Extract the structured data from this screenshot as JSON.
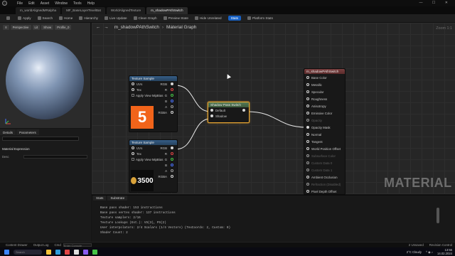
{
  "menubar": {
    "items": [
      "File",
      "Edit",
      "Asset",
      "Window",
      "Tools",
      "Help"
    ]
  },
  "tabs": [
    {
      "label": "m_worldAlignedMRalpha",
      "active": false
    },
    {
      "label": "MF_BaseLayerTexelBat",
      "active": false
    },
    {
      "label": "WorldAlignedTexture",
      "active": false
    },
    {
      "label": "m_shadowPAthSwitch",
      "active": true
    }
  ],
  "toolbar": {
    "save": "Save",
    "apply": "Apply",
    "search": "Search",
    "home": "Home",
    "hierarchy": "Hierarchy",
    "live_update": "Live Update",
    "clean_graph": "Clean Graph",
    "preview_state": "Preview State",
    "hide_unrelated": "Hide Unrelated",
    "stats": "Stats",
    "platform_stats": "Platform Stats"
  },
  "viewport": {
    "perspective": "Perspective",
    "lit": "Lit",
    "show": "Show",
    "profile": "Profile_0"
  },
  "details": {
    "tab_details": "Details",
    "tab_parameters": "Parameters",
    "section": "Material Expression",
    "desc_label": "Desc"
  },
  "graph": {
    "breadcrumb_asset": "m_shadowPAthSwitch",
    "breadcrumb_graph": "Material Graph",
    "zoom": "Zoom 1:1",
    "watermark": "MATERIAL"
  },
  "nodes": {
    "tex1": {
      "title": "Texture Sample",
      "uvs": "UVs",
      "tex": "Tex",
      "apply_mip": "Apply View MipBias",
      "outputs": [
        "RGB",
        "R",
        "G",
        "B",
        "A",
        "RGBA"
      ],
      "thumb_label": "5"
    },
    "tex2": {
      "title": "Texture Sample",
      "uvs": "UVs",
      "tex": "Tex",
      "apply_mip": "Apply View MipBias",
      "outputs": [
        "RGB",
        "R",
        "G",
        "B",
        "A",
        "RGBA"
      ],
      "thumb_label": "3500"
    },
    "switch": {
      "title": "Shadow Pass Switch",
      "input_default": "Default",
      "input_shadow": "Shadow"
    },
    "result": {
      "title": "m_shadowPAthSwitch",
      "pins": [
        {
          "label": "Base Color",
          "dim": false
        },
        {
          "label": "Metallic",
          "dim": false
        },
        {
          "label": "Specular",
          "dim": false
        },
        {
          "label": "Roughness",
          "dim": false
        },
        {
          "label": "Anisotropy",
          "dim": false
        },
        {
          "label": "Emissive Color",
          "dim": false
        },
        {
          "label": "Opacity",
          "dim": true
        },
        {
          "label": "Opacity Mask",
          "dim": false
        },
        {
          "label": "Normal",
          "dim": false
        },
        {
          "label": "Tangent",
          "dim": false
        },
        {
          "label": "World Position Offset",
          "dim": false
        },
        {
          "label": "Subsurface Color",
          "dim": true
        },
        {
          "label": "Custom Data 0",
          "dim": true
        },
        {
          "label": "Custom Data 1",
          "dim": true
        },
        {
          "label": "Ambient Occlusion",
          "dim": false
        },
        {
          "label": "Refraction (Disabled)",
          "dim": true
        },
        {
          "label": "Pixel Depth Offset",
          "dim": false
        }
      ]
    }
  },
  "stats": {
    "tab_stats": "Stats",
    "tab_substrate": "Substrate",
    "lines": [
      "Base pass shader: 153 instructions",
      "Base pass vertex shader: 137 instructions",
      "Texture samplers: 2/16",
      "Texture Lookups (Est.): VS(3), PS(2)",
      "User interpolators: 2/4 Scalars (1/4 Vectors) (TexCoords: 2, Custom: 0)",
      "Shader Count: 2"
    ]
  },
  "statusbar": {
    "content_drawer": "Content Drawer",
    "output_log": "Output Log",
    "cmd": "Cmd",
    "cmd_placeholder": "Enter Console Command",
    "unsaved": "2 Unsaved",
    "revision_control": "Revision Control"
  },
  "taskbar": {
    "search_placeholder": "Search",
    "weather": "2°C  Cloudy",
    "time": "13:56",
    "date": "14.02.2024"
  },
  "colors": {
    "accent_blue": "#1761c4",
    "switch_highlight": "#e8a632",
    "thumb_orange": "#f2641a"
  }
}
